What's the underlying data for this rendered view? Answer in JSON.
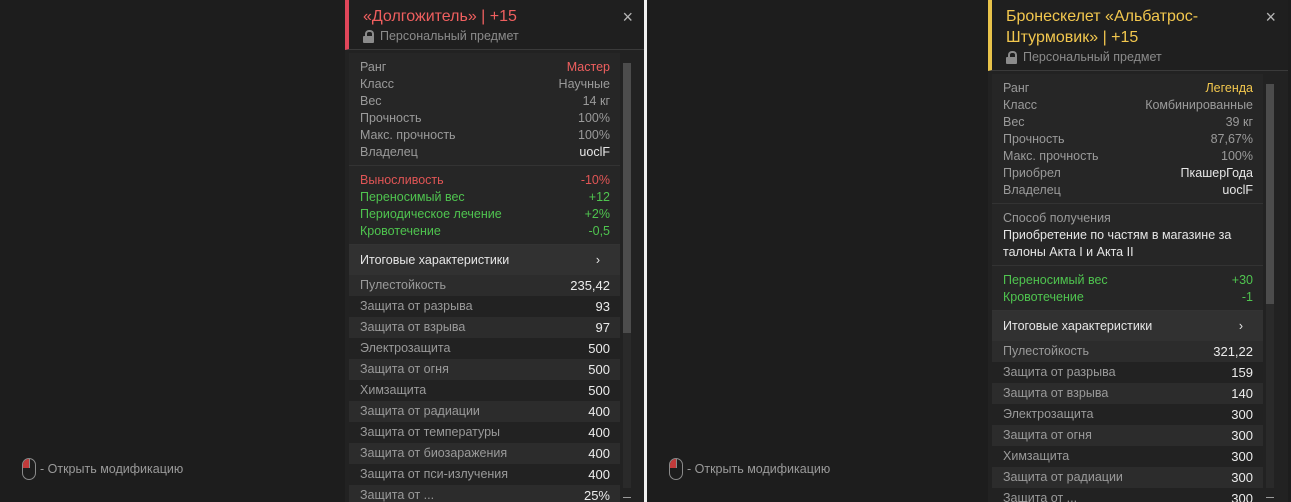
{
  "hint_label": "- Открыть модификацию",
  "summary_label": "Итоговые характеристики",
  "summary_chevron": "›",
  "close_glyph": "×",
  "left": {
    "title": "«Долгожитель» | +15",
    "subtitle": "Персональный предмет",
    "accent": "#e0465a",
    "info": [
      {
        "k": "Ранг",
        "v": "Мастер",
        "cls": "red"
      },
      {
        "k": "Класс",
        "v": "Научные",
        "cls": ""
      },
      {
        "k": "Вес",
        "v": "14 кг",
        "cls": ""
      },
      {
        "k": "Прочность",
        "v": "100%",
        "cls": ""
      },
      {
        "k": "Макс. прочность",
        "v": "100%",
        "cls": ""
      },
      {
        "k": "Владелец",
        "v": "uoclF",
        "cls": "white"
      }
    ],
    "mods": [
      {
        "k": "Выносливость",
        "v": "-10%",
        "type": "bad"
      },
      {
        "k": "Переносимый вес",
        "v": "+12",
        "type": "good"
      },
      {
        "k": "Периодическое лечение",
        "v": "+2%",
        "type": "good"
      },
      {
        "k": "Кровотечение",
        "v": "-0,5",
        "type": "good"
      }
    ],
    "stats": [
      {
        "k": "Пулестойкость",
        "v": "235,42"
      },
      {
        "k": "Защита от разрыва",
        "v": "93"
      },
      {
        "k": "Защита от взрыва",
        "v": "97"
      },
      {
        "k": "Электрозащита",
        "v": "500"
      },
      {
        "k": "Защита от огня",
        "v": "500"
      },
      {
        "k": "Химзащита",
        "v": "500"
      },
      {
        "k": "Защита от радиации",
        "v": "400"
      },
      {
        "k": "Защита от температуры",
        "v": "400"
      },
      {
        "k": "Защита от биозаражения",
        "v": "400"
      },
      {
        "k": "Защита от пси-излучения",
        "v": "400"
      },
      {
        "k": "Защита от ...",
        "v": "25%"
      }
    ]
  },
  "right": {
    "title": "Бронескелет «Альбатрос-Штурмовик» | +15",
    "subtitle": "Персональный предмет",
    "accent": "#e8c34a",
    "info": [
      {
        "k": "Ранг",
        "v": "Легенда",
        "cls": "gold"
      },
      {
        "k": "Класс",
        "v": "Комбинированные",
        "cls": ""
      },
      {
        "k": "Вес",
        "v": "39 кг",
        "cls": ""
      },
      {
        "k": "Прочность",
        "v": "87,67%",
        "cls": ""
      },
      {
        "k": "Макс. прочность",
        "v": "100%",
        "cls": ""
      },
      {
        "k": "Приобрел",
        "v": "ПкашерГода",
        "cls": "white"
      },
      {
        "k": "Владелец",
        "v": "uoclF",
        "cls": "white"
      }
    ],
    "acq_label": "Способ получения",
    "acq_text": "Приобретение по частям в магазине за талоны Акта I и Акта II",
    "mods": [
      {
        "k": "Переносимый вес",
        "v": "+30",
        "type": "good"
      },
      {
        "k": "Кровотечение",
        "v": "-1",
        "type": "good"
      }
    ],
    "stats": [
      {
        "k": "Пулестойкость",
        "v": "321,22"
      },
      {
        "k": "Защита от разрыва",
        "v": "159"
      },
      {
        "k": "Защита от взрыва",
        "v": "140"
      },
      {
        "k": "Электрозащита",
        "v": "300"
      },
      {
        "k": "Защита от огня",
        "v": "300"
      },
      {
        "k": "Химзащита",
        "v": "300"
      },
      {
        "k": "Защита от радиации",
        "v": "300"
      },
      {
        "k": "Защита от ...",
        "v": "300"
      }
    ]
  }
}
